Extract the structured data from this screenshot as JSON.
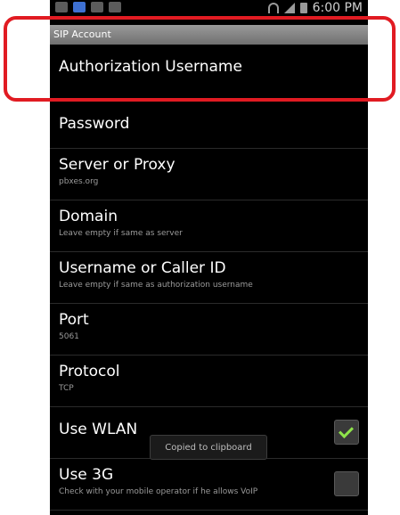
{
  "statusbar": {
    "time": "6:00 PM"
  },
  "section": {
    "title": "SIP Account"
  },
  "settings": [
    {
      "title": "Authorization Username",
      "summary": ""
    },
    {
      "title": "Password",
      "summary": ""
    },
    {
      "title": "Server or Proxy",
      "summary": "pbxes.org"
    },
    {
      "title": "Domain",
      "summary": "Leave empty if same as server"
    },
    {
      "title": "Username or Caller ID",
      "summary": "Leave empty if same as authorization username"
    },
    {
      "title": "Port",
      "summary": "5061"
    },
    {
      "title": "Protocol",
      "summary": "TCP"
    },
    {
      "title": "Use WLAN",
      "summary": "",
      "checked": true
    },
    {
      "title": "Use 3G",
      "summary": "Check with your mobile operator if he allows VoIP",
      "checked": false
    }
  ],
  "toast": {
    "text": "Copied to clipboard"
  },
  "colors": {
    "highlight": "#e11b22",
    "check": "#8ee34a",
    "background": "#000000"
  }
}
